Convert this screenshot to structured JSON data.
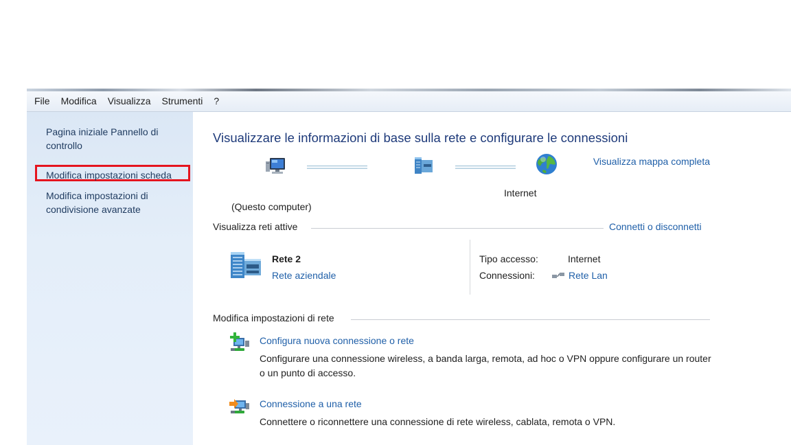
{
  "menu": [
    "File",
    "Modifica",
    "Visualizza",
    "Strumenti",
    "?"
  ],
  "sidebar": {
    "home": "Pagina iniziale Pannello di controllo",
    "adapter": "Modifica impostazioni scheda",
    "sharing": "Modifica impostazioni di condivisione avanzate"
  },
  "main": {
    "title": "Visualizzare le informazioni di base sulla rete e configurare le connessioni",
    "map_link": "Visualizza mappa completa",
    "computer_label": "(Questo computer)",
    "internet_label": "Internet",
    "active_section": "Visualizza reti attive",
    "connect_link": "Connetti o disconnetti",
    "network": {
      "name": "Rete  2",
      "type_link": "Rete aziendale",
      "access_label": "Tipo accesso:",
      "access_value": "Internet",
      "conn_label": "Connessioni:",
      "conn_value": "Rete Lan"
    },
    "settings_section": "Modifica impostazioni di rete",
    "tasks": [
      {
        "title": "Configura nuova connessione o rete",
        "desc": "Configurare una connessione wireless, a banda larga, remota, ad hoc o VPN oppure configurare un router o un punto di accesso."
      },
      {
        "title": "Connessione a una rete",
        "desc": "Connettere o riconnettere una connessione di rete wireless, cablata, remota o VPN."
      }
    ]
  }
}
